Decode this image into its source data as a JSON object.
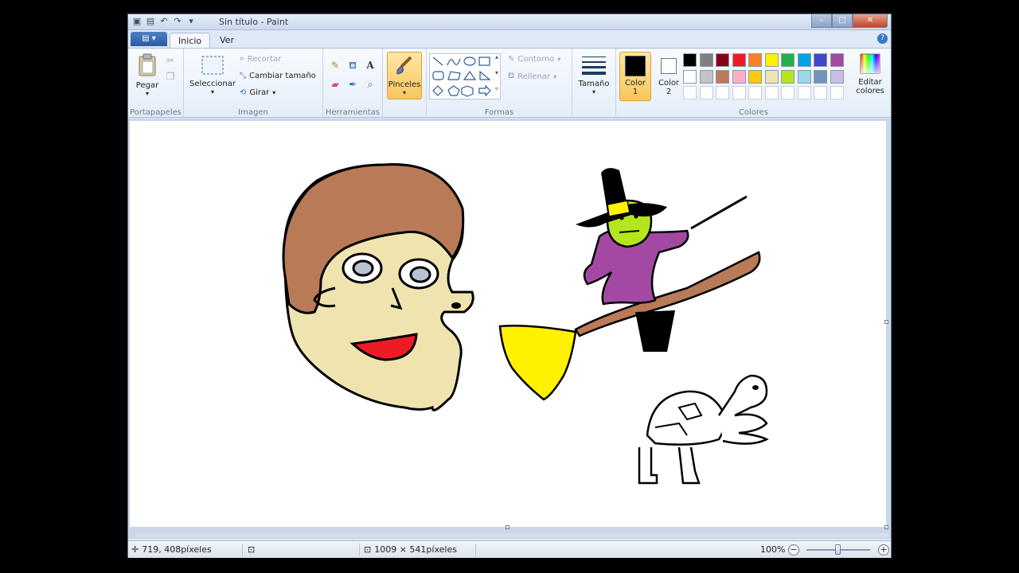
{
  "window": {
    "title": "Sin título - Paint"
  },
  "tabs": {
    "inicio": "Inicio",
    "ver": "Ver"
  },
  "ribbon": {
    "portapapeles": {
      "label": "Portapapeles",
      "pegar": "Pegar"
    },
    "imagen": {
      "label": "Imagen",
      "seleccionar": "Seleccionar",
      "recortar": "Recortar",
      "cambiar_tamano": "Cambiar tamaño",
      "girar": "Girar"
    },
    "herramientas": {
      "label": "Herramientas"
    },
    "pinceles": "Pinceles",
    "formas": {
      "label": "Formas",
      "contorno": "Contorno",
      "rellenar": "Rellenar"
    },
    "tamano": "Tamaño",
    "color1": {
      "line1": "Color",
      "line2": "1",
      "value": "#000000"
    },
    "color2": {
      "line1": "Color",
      "line2": "2",
      "value": "#ffffff"
    },
    "colores": {
      "label": "Colores",
      "editar_line1": "Editar",
      "editar_line2": "colores",
      "palette_row1": [
        "#000000",
        "#7f7f7f",
        "#880015",
        "#ed1c24",
        "#ff7f27",
        "#fff200",
        "#22b14c",
        "#00a2e8",
        "#3f48cc",
        "#a349a4"
      ],
      "palette_row2": [
        "#ffffff",
        "#c3c3c3",
        "#b97a57",
        "#ffaec9",
        "#ffc90e",
        "#efe4b0",
        "#b5e61d",
        "#99d9ea",
        "#7092be",
        "#c8bfe7"
      ]
    }
  },
  "status": {
    "cursor_pos": "719, 408píxeles",
    "image_size": "1009 × 541píxeles",
    "zoom": "100%",
    "zoom_level_fraction": 0.5
  }
}
